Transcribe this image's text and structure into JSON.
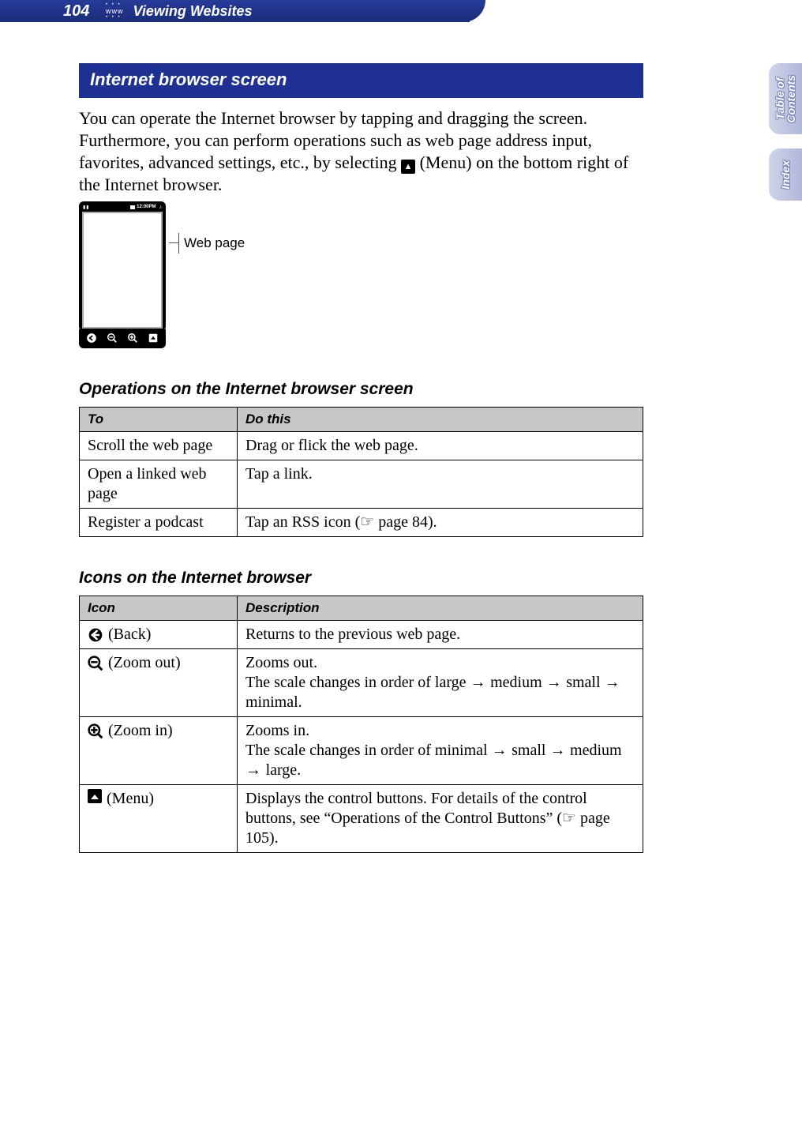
{
  "header": {
    "page_number": "104",
    "www_label": "www",
    "section_title": "Viewing Websites"
  },
  "side_tabs": {
    "toc": "Table of\nContents",
    "index": "Index"
  },
  "main": {
    "heading": "Internet browser screen",
    "intro_part1": "You can operate the Internet browser by tapping and dragging the screen. Furthermore, you can perform operations such as web page address input, favorites, advanced settings, etc., by selecting ",
    "intro_icon_label": "(Menu)",
    "intro_part2": " on the bottom right of the Internet browser.",
    "device": {
      "status_pause": "▮▮",
      "status_time": "12:00PM",
      "callout_webpage": "Web page"
    },
    "ops_heading": "Operations on the Internet browser screen",
    "ops_table": {
      "col_to": "To",
      "col_do": "Do this",
      "rows": [
        {
          "to": "Scroll the web page",
          "do": "Drag or flick the web page."
        },
        {
          "to": "Open a linked web page",
          "do": "Tap a link."
        },
        {
          "to": "Register a podcast",
          "do_pre": "Tap an RSS icon (",
          "do_hand": "☞",
          "do_post": " page 84)."
        }
      ]
    },
    "icons_heading": "Icons on the Internet browser",
    "icons_table": {
      "col_icon": "Icon",
      "col_desc": "Description",
      "rows": [
        {
          "name": "back-icon",
          "label": "(Back)",
          "desc": "Returns to the previous web page."
        },
        {
          "name": "zoom-out-icon",
          "label": "(Zoom out)",
          "desc_pre": "Zooms out.\nThe scale changes in order of large ",
          "desc_chain": [
            "medium",
            "small",
            "minimal."
          ]
        },
        {
          "name": "zoom-in-icon",
          "label": "(Zoom in)",
          "desc_pre": "Zooms in.\nThe scale changes in order of minimal ",
          "desc_chain": [
            "small",
            "medium",
            "large."
          ]
        },
        {
          "name": "menu-icon",
          "label": "(Menu)",
          "desc_pre": "Displays the control buttons. For details of the control buttons, see “Operations of the Control Buttons” (",
          "desc_hand": "☞",
          "desc_post": " page 105)."
        }
      ]
    }
  }
}
